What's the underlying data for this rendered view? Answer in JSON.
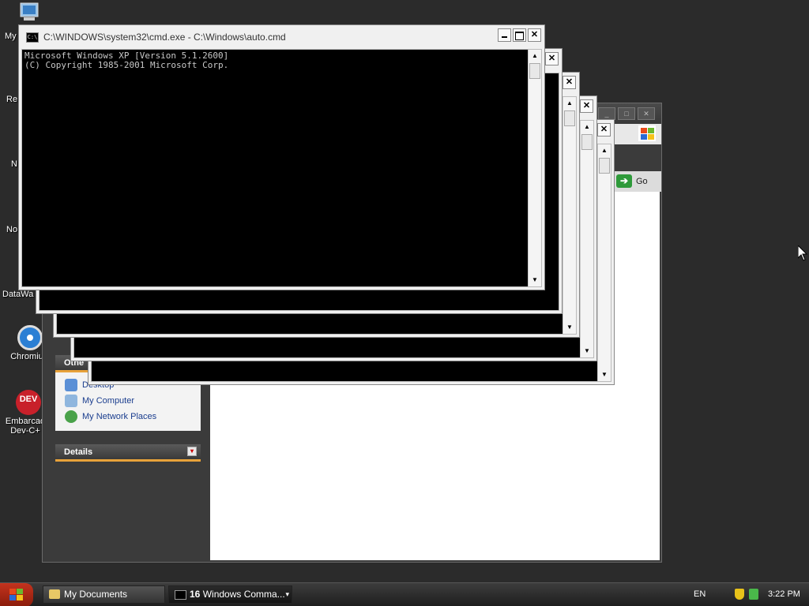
{
  "desktop": {
    "icons": [
      {
        "label": "My"
      },
      {
        "label": "Re"
      },
      {
        "label": "N"
      },
      {
        "label": "No"
      },
      {
        "label": "DataWa"
      },
      {
        "label": "Chromiu"
      },
      {
        "label": "Embarcad Dev-C+"
      }
    ],
    "devcpp_badge": "DEV"
  },
  "explorer": {
    "go_label": "Go",
    "panels": {
      "other_places": {
        "title": "Othe",
        "items": [
          "Desktop",
          "My Computer",
          "My Network Places"
        ]
      },
      "details": {
        "title": "Details"
      }
    }
  },
  "cmd": {
    "title": "C:\\WINDOWS\\system32\\cmd.exe - C:\\Windows\\auto.cmd",
    "icon_text": "C:\\",
    "console_lines": [
      "Microsoft Windows XP [Version 5.1.2600]",
      "(C) Copyright 1985-2001 Microsoft Corp."
    ]
  },
  "taskbar": {
    "tasks": [
      {
        "label": "My Documents"
      },
      {
        "count": "16",
        "label": "Windows Comma..."
      }
    ],
    "language": "EN",
    "clock": "3:22 PM"
  },
  "colors": {
    "desktop_bg": "#2b2b2b",
    "accent_orange": "#e8a23a",
    "start_red": "#c4331e"
  }
}
